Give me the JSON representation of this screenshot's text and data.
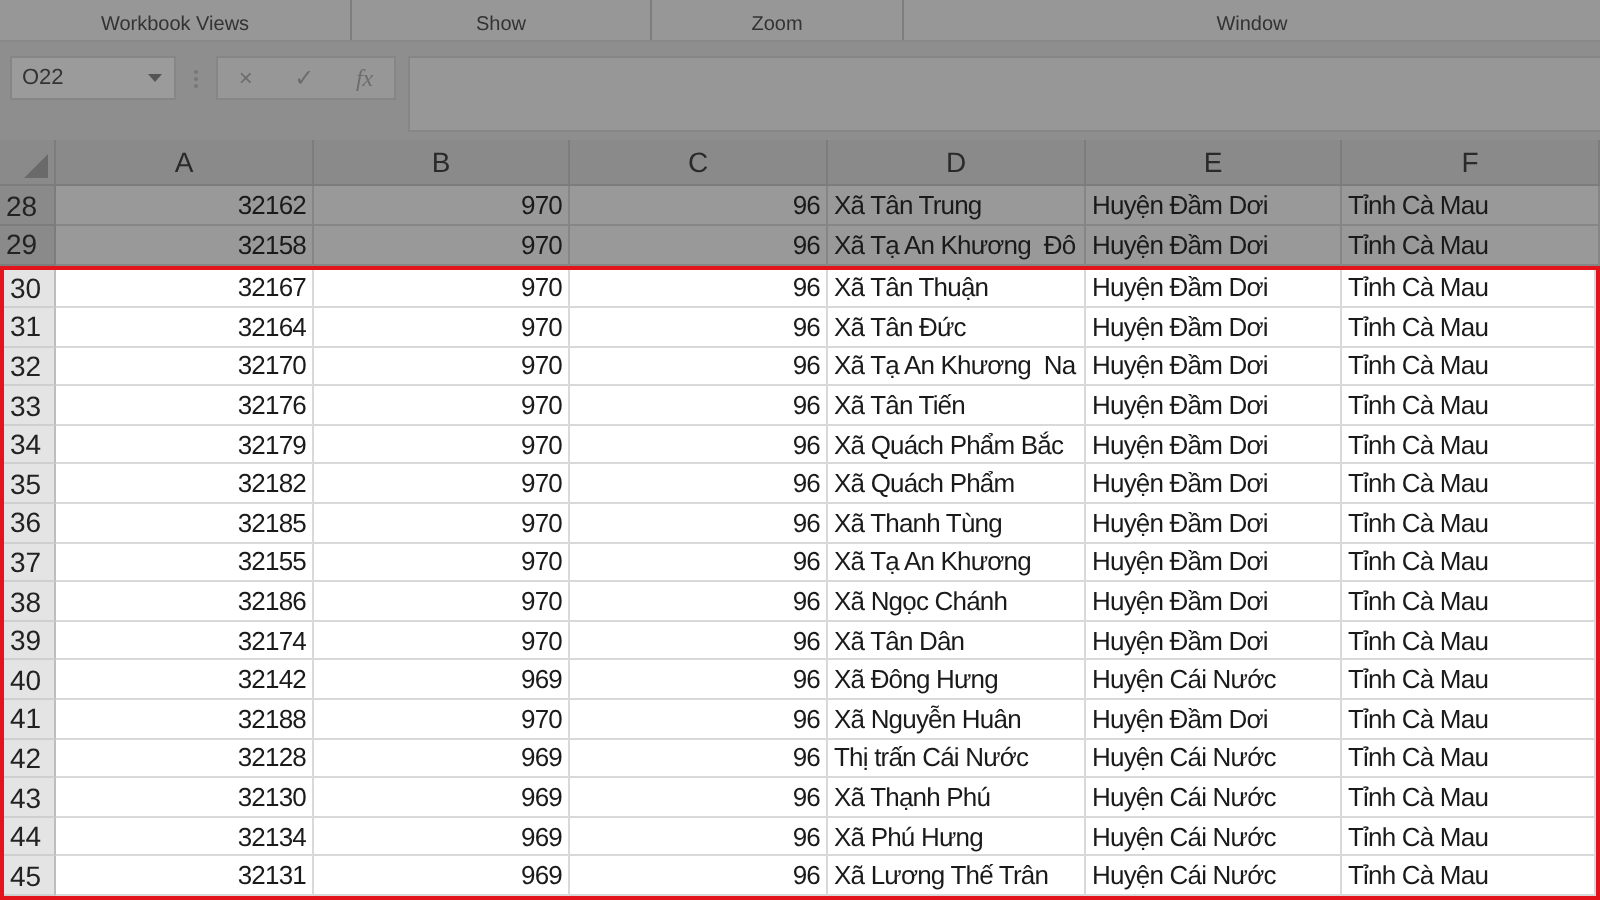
{
  "ribbon": {
    "groups": [
      "Workbook Views",
      "Show",
      "Zoom",
      "Window"
    ]
  },
  "formula_bar": {
    "name_box": "O22",
    "cancel": "×",
    "enter": "✓",
    "function": "fx"
  },
  "table": {
    "columns": [
      "A",
      "B",
      "C",
      "D",
      "E",
      "F"
    ],
    "rows": [
      {
        "row": "28",
        "cells": [
          "32162",
          "970",
          "96",
          "Xã Tân Trung",
          "Huyện Đầm Dơi",
          "Tỉnh Cà Mau"
        ],
        "highlighted": false
      },
      {
        "row": "29",
        "cells": [
          "32158",
          "970",
          "96",
          "Xã Tạ An Khương  Đô",
          "Huyện Đầm Dơi",
          "Tỉnh Cà Mau"
        ],
        "highlighted": false
      },
      {
        "row": "30",
        "cells": [
          "32167",
          "970",
          "96",
          "Xã Tân Thuận",
          "Huyện Đầm Dơi",
          "Tỉnh Cà Mau"
        ],
        "highlighted": true
      },
      {
        "row": "31",
        "cells": [
          "32164",
          "970",
          "96",
          "Xã Tân Đức",
          "Huyện Đầm Dơi",
          "Tỉnh Cà Mau"
        ],
        "highlighted": true
      },
      {
        "row": "32",
        "cells": [
          "32170",
          "970",
          "96",
          "Xã Tạ An Khương  Na",
          "Huyện Đầm Dơi",
          "Tỉnh Cà Mau"
        ],
        "highlighted": true
      },
      {
        "row": "33",
        "cells": [
          "32176",
          "970",
          "96",
          "Xã Tân Tiến",
          "Huyện Đầm Dơi",
          "Tỉnh Cà Mau"
        ],
        "highlighted": true
      },
      {
        "row": "34",
        "cells": [
          "32179",
          "970",
          "96",
          "Xã Quách Phẩm Bắc",
          "Huyện Đầm Dơi",
          "Tỉnh Cà Mau"
        ],
        "highlighted": true
      },
      {
        "row": "35",
        "cells": [
          "32182",
          "970",
          "96",
          "Xã Quách Phẩm",
          "Huyện Đầm Dơi",
          "Tỉnh Cà Mau"
        ],
        "highlighted": true
      },
      {
        "row": "36",
        "cells": [
          "32185",
          "970",
          "96",
          "Xã Thanh Tùng",
          "Huyện Đầm Dơi",
          "Tỉnh Cà Mau"
        ],
        "highlighted": true
      },
      {
        "row": "37",
        "cells": [
          "32155",
          "970",
          "96",
          "Xã Tạ An Khương",
          "Huyện Đầm Dơi",
          "Tỉnh Cà Mau"
        ],
        "highlighted": true
      },
      {
        "row": "38",
        "cells": [
          "32186",
          "970",
          "96",
          "Xã Ngọc Chánh",
          "Huyện Đầm Dơi",
          "Tỉnh Cà Mau"
        ],
        "highlighted": true
      },
      {
        "row": "39",
        "cells": [
          "32174",
          "970",
          "96",
          "Xã Tân Dân",
          "Huyện Đầm Dơi",
          "Tỉnh Cà Mau"
        ],
        "highlighted": true
      },
      {
        "row": "40",
        "cells": [
          "32142",
          "969",
          "96",
          "Xã Đông Hưng",
          "Huyện Cái Nước",
          "Tỉnh Cà Mau"
        ],
        "highlighted": true
      },
      {
        "row": "41",
        "cells": [
          "32188",
          "970",
          "96",
          "Xã Nguyễn Huân",
          "Huyện Đầm Dơi",
          "Tỉnh Cà Mau"
        ],
        "highlighted": true
      },
      {
        "row": "42",
        "cells": [
          "32128",
          "969",
          "96",
          "Thị trấn Cái Nước",
          "Huyện Cái Nước",
          "Tỉnh Cà Mau"
        ],
        "highlighted": true
      },
      {
        "row": "43",
        "cells": [
          "32130",
          "969",
          "96",
          "Xã Thạnh Phú",
          "Huyện Cái Nước",
          "Tỉnh Cà Mau"
        ],
        "highlighted": true
      },
      {
        "row": "44",
        "cells": [
          "32134",
          "969",
          "96",
          "Xã Phú Hưng",
          "Huyện Cái Nước",
          "Tỉnh Cà Mau"
        ],
        "highlighted": true
      },
      {
        "row": "45",
        "cells": [
          "32131",
          "969",
          "96",
          "Xã Lương Thế Trân",
          "Huyện Cái Nước",
          "Tỉnh Cà Mau"
        ],
        "highlighted": true
      }
    ]
  }
}
